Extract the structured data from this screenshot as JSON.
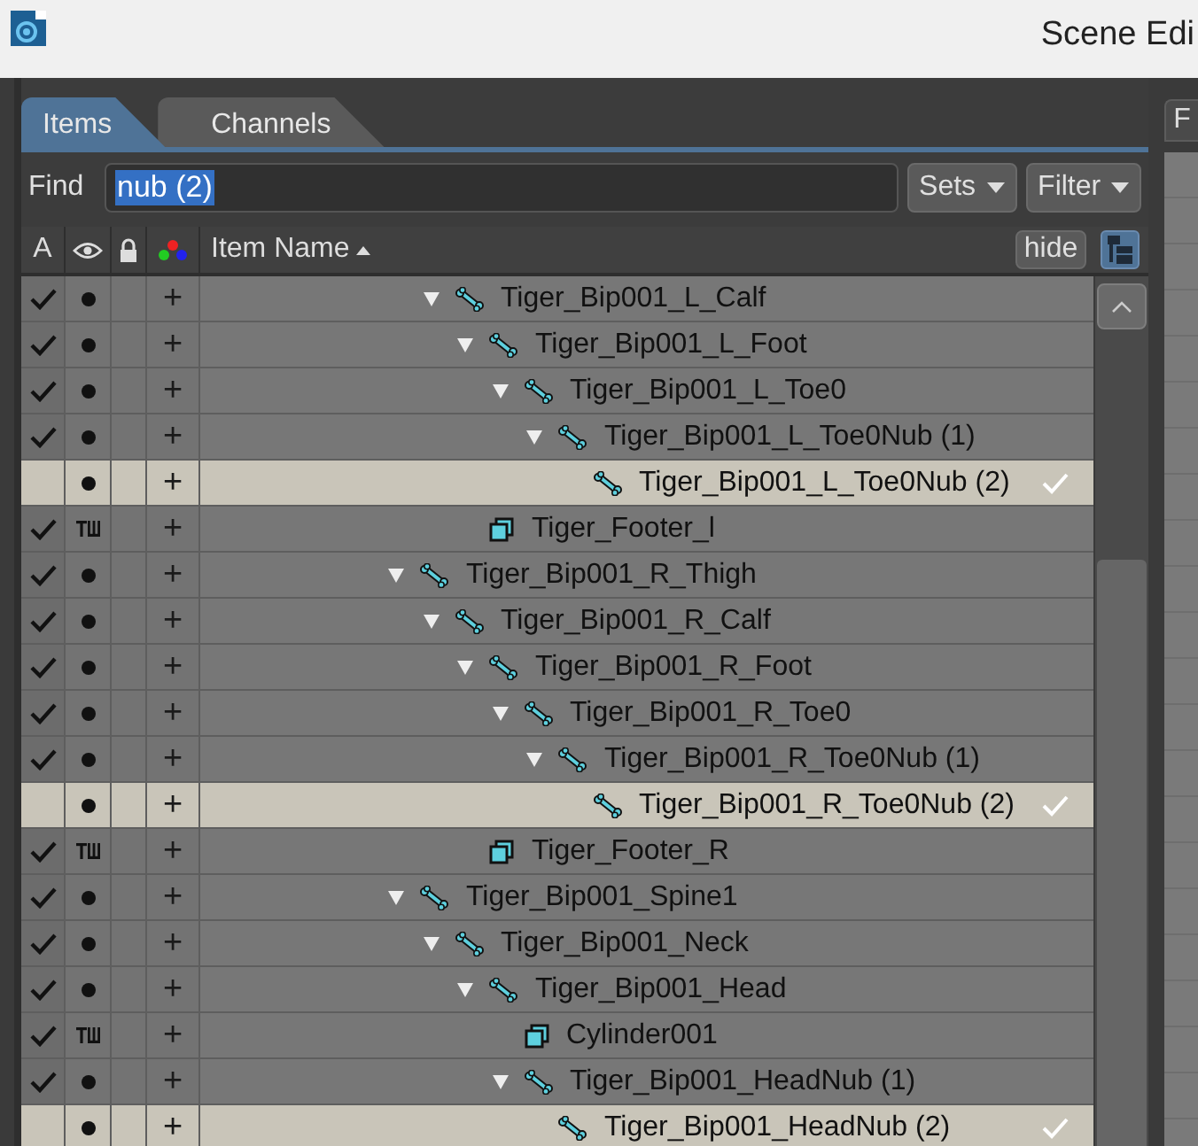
{
  "window": {
    "title": "Scene Edi"
  },
  "tabs": [
    {
      "label": "Items",
      "selected": true
    },
    {
      "label": "Channels",
      "selected": false
    }
  ],
  "right_panel": {
    "tab_label": "F"
  },
  "find": {
    "label": "Find",
    "value": "nub (2)"
  },
  "buttons": [
    "Sets",
    "Filter"
  ],
  "header": {
    "column_a": "A",
    "name_column": "Item Name",
    "hide_button": "hide"
  },
  "tree": [
    {
      "children": [
        {
          "name": "Tiger_Bip001_L_Calf",
          "kind": "bone",
          "active": true,
          "shaded": true,
          "plus": "+",
          "selected": false,
          "expanded": true,
          "children": [
            {
              "name": "Tiger_Bip001_L_Foot",
              "kind": "bone",
              "active": true,
              "shaded": true,
              "plus": "+",
              "selected": false,
              "expanded": true,
              "children": [
                {
                  "name": "Tiger_Bip001_L_Toe0",
                  "kind": "bone",
                  "active": true,
                  "shaded": true,
                  "plus": "+",
                  "selected": false,
                  "expanded": true,
                  "children": [
                    {
                      "name": "Tiger_Bip001_L_Toe0Nub (1)",
                      "kind": "bone",
                      "active": true,
                      "shaded": true,
                      "plus": "+",
                      "selected": false,
                      "expanded": true,
                      "children": [
                        {
                          "name": "Tiger_Bip001_L_Toe0Nub (2)",
                          "kind": "bone",
                          "active": false,
                          "shaded": true,
                          "plus": "+",
                          "selected": true
                        }
                      ]
                    }
                  ]
                }
              ]
            },
            {
              "name": "Tiger_Footer_l",
              "kind": "mesh",
              "active": true,
              "shaded": false,
              "plus": "+",
              "selected": false
            }
          ]
        }
      ]
    },
    {
      "name": "Tiger_Bip001_R_Thigh",
      "kind": "bone",
      "active": true,
      "shaded": true,
      "plus": "+",
      "selected": false,
      "expanded": true,
      "children": [
        {
          "name": "Tiger_Bip001_R_Calf",
          "kind": "bone",
          "active": true,
          "shaded": true,
          "plus": "+",
          "selected": false,
          "expanded": true,
          "children": [
            {
              "name": "Tiger_Bip001_R_Foot",
              "kind": "bone",
              "active": true,
              "shaded": true,
              "plus": "+",
              "selected": false,
              "expanded": true,
              "children": [
                {
                  "name": "Tiger_Bip001_R_Toe0",
                  "kind": "bone",
                  "active": true,
                  "shaded": true,
                  "plus": "+",
                  "selected": false,
                  "expanded": true,
                  "children": [
                    {
                      "name": "Tiger_Bip001_R_Toe0Nub (1)",
                      "kind": "bone",
                      "active": true,
                      "shaded": true,
                      "plus": "+",
                      "selected": false,
                      "expanded": true,
                      "children": [
                        {
                          "name": "Tiger_Bip001_R_Toe0Nub (2)",
                          "kind": "bone",
                          "active": false,
                          "shaded": true,
                          "plus": "+",
                          "selected": true
                        }
                      ]
                    }
                  ]
                }
              ]
            },
            {
              "name": "Tiger_Footer_R",
              "kind": "mesh",
              "active": true,
              "shaded": false,
              "plus": "+",
              "selected": false
            }
          ]
        }
      ]
    },
    {
      "name": "Tiger_Bip001_Spine1",
      "kind": "bone",
      "active": true,
      "shaded": true,
      "plus": "+",
      "selected": false,
      "expanded": true,
      "children": [
        {
          "name": "Tiger_Bip001_Neck",
          "kind": "bone",
          "active": true,
          "shaded": true,
          "plus": "+",
          "selected": false,
          "expanded": true,
          "children": [
            {
              "name": "Tiger_Bip001_Head",
              "kind": "bone",
              "active": true,
              "shaded": true,
              "plus": "+",
              "selected": false,
              "expanded": true,
              "children": [
                {
                  "name": "Cylinder001",
                  "kind": "mesh",
                  "active": true,
                  "shaded": false,
                  "plus": "+",
                  "selected": false
                },
                {
                  "name": "Tiger_Bip001_HeadNub (1)",
                  "kind": "bone",
                  "active": true,
                  "shaded": true,
                  "plus": "+",
                  "selected": false,
                  "expanded": true,
                  "children": [
                    {
                      "name": "Tiger_Bip001_HeadNub (2)",
                      "kind": "bone",
                      "active": false,
                      "shaded": true,
                      "plus": "+",
                      "selected": true
                    }
                  ]
                }
              ]
            }
          ]
        }
      ]
    }
  ]
}
